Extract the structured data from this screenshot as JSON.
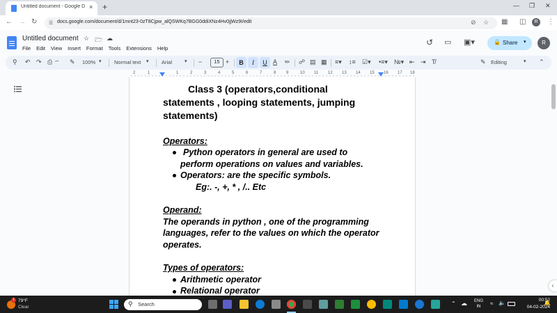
{
  "browser": {
    "tab_title": "Untitled document - Google Do",
    "tab_close": "×",
    "new_tab": "+",
    "url": "docs.google.com/document/d/1mnt23-0zT8Cjpw_alQSWKq7BGG0ddiXNz4Hv0jjWz9I/edit",
    "profile_initial": "R"
  },
  "docs": {
    "title": "Untitled document",
    "menu": [
      "File",
      "Edit",
      "View",
      "Insert",
      "Format",
      "Tools",
      "Extensions",
      "Help"
    ],
    "share_label": "Share",
    "user_initial": "R"
  },
  "toolbar": {
    "zoom": "100%",
    "style": "Normal text",
    "font": "Arial",
    "font_size": "15",
    "mode": "Editing"
  },
  "ruler": {
    "numbers": [
      "2",
      "1",
      "1",
      "2",
      "3",
      "4",
      "5",
      "6",
      "7",
      "8",
      "9",
      "10",
      "11",
      "12",
      "13",
      "14",
      "15",
      "16",
      "17",
      "18"
    ]
  },
  "document": {
    "title_lines": [
      "Class 3  (operators,conditional",
      "statements , looping statements, jumping",
      "statements)"
    ],
    "operators_heading": "Operators:",
    "operators_bullet1_line1": "Python operators in general are used to",
    "operators_bullet1_line2": "perform operations on values and variables.",
    "operators_bullet2": "Operators: are the specific symbols.",
    "operators_example": "Eg:.   -, +, * , /.. Etc",
    "operand_heading": "Operand:",
    "operand_lines": [
      "The operands in python , one of the programming",
      "languages, refer to the values on which the operator",
      "operates."
    ],
    "types_heading": "Types of operators:",
    "types_list": [
      "Arithmetic operator",
      "Relational operator"
    ]
  },
  "taskbar": {
    "weather_temp": "79°F",
    "weather_desc": "Clear",
    "search_placeholder": "Search",
    "lang_line1": "ENG",
    "lang_line2": "IN",
    "time": "00:52",
    "date": "04-02-2024",
    "notification_count": "1"
  },
  "colors": {
    "accent": "#0b57d0",
    "share_bg": "#c2e7ff",
    "taskbar_bg": "#1c1c1c"
  }
}
